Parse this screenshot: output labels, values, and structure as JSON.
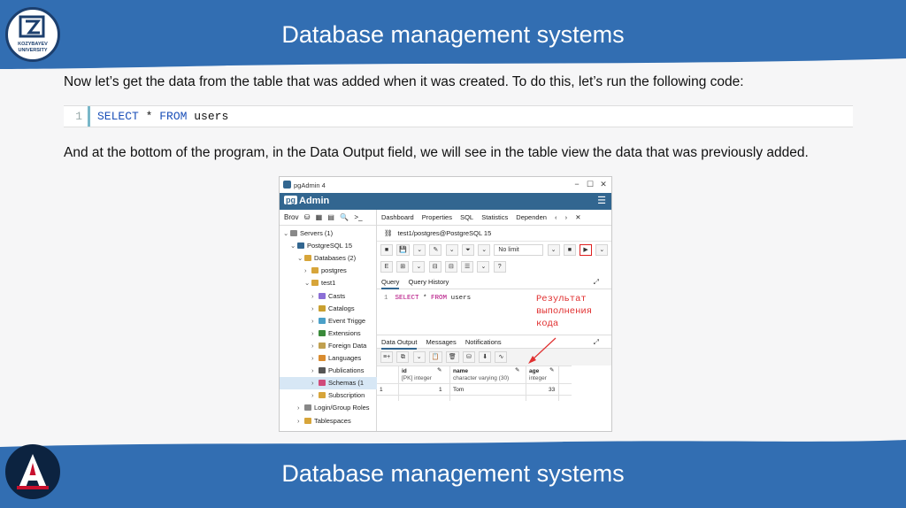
{
  "slide": {
    "title": "Database management systems",
    "footer_title": "Database management systems",
    "logo_text": "KOZYBAYEV UNIVERSITY",
    "para1": "Now let’s get the data from the table that was added when it was created. To do this, let’s run the following code:",
    "para2": "And at the bottom of the program, in the Data Output field, we will see in the table view the data that was previously added.",
    "code": {
      "line_number": "1",
      "kw1": "SELECT",
      "star": " * ",
      "kw2": "FROM",
      "rest": " users"
    }
  },
  "colors": {
    "band": "#326eb2",
    "band_dark": "#2a5f9a",
    "pgadmin": "#326690",
    "annotation": "#e03030"
  },
  "pgadmin": {
    "window_title": "pgAdmin 4",
    "brand_pg": "pg",
    "brand_admin": "Admin",
    "left_toolbar": [
      "Brov",
      "⛁",
      "▦",
      "▤",
      "🔍",
      ">_"
    ],
    "tree": [
      {
        "label": "Servers (1)",
        "chev": "⌄",
        "icon": "#888888"
      },
      {
        "label": "PostgreSQL 15",
        "chev": "⌄",
        "icon": "#326690"
      },
      {
        "label": "Databases (2)",
        "chev": "⌄",
        "icon": "#d7a53a"
      },
      {
        "label": "postgres",
        "chev": "›",
        "icon": "#d7a53a"
      },
      {
        "label": "test1",
        "chev": "⌄",
        "icon": "#d7a53a"
      },
      {
        "label": "Casts",
        "chev": "›",
        "icon": "#8b6fd6"
      },
      {
        "label": "Catalogs",
        "chev": "›",
        "icon": "#c9a030"
      },
      {
        "label": "Event Trigge",
        "chev": "›",
        "icon": "#4aa0c8"
      },
      {
        "label": "Extensions",
        "chev": "›",
        "icon": "#3a8a3a"
      },
      {
        "label": "Foreign Data",
        "chev": "›",
        "icon": "#c0a050"
      },
      {
        "label": "Languages",
        "chev": "›",
        "icon": "#d98c30"
      },
      {
        "label": "Publications",
        "chev": "›",
        "icon": "#555555"
      },
      {
        "label": "Schemas (1",
        "chev": "›",
        "icon": "#d04a7a"
      },
      {
        "label": "Subscription",
        "chev": "›",
        "icon": "#d7a53a"
      },
      {
        "label": "Login/Group Roles",
        "chev": "›",
        "icon": "#888888"
      },
      {
        "label": "Tablespaces",
        "chev": "›",
        "icon": "#d7a53a"
      }
    ],
    "tabs": [
      "Dashboard",
      "Properties",
      "SQL",
      "Statistics",
      "Dependen",
      "‹",
      "›",
      "✕"
    ],
    "connection": "test1/postgres@PostgreSQL 15",
    "toolbar1": [
      "■",
      "💾",
      "⌄",
      "✎",
      "⌄",
      "⏷",
      "⌄",
      "No limit",
      "⌄",
      "■",
      "▶",
      "⌄"
    ],
    "toolbar2": [
      "E",
      "⊞",
      "⌄",
      "⊟",
      "⊟",
      "☰",
      "⌄",
      "?"
    ],
    "query_tabs": [
      "Query",
      "Query History"
    ],
    "editor": {
      "line": "1",
      "kw1": "SELECT",
      "star": " * ",
      "kw2": "FROM",
      "rest": " users"
    },
    "annotation": [
      "Результат",
      "выполнения",
      "кода"
    ],
    "output_tabs": [
      "Data Output",
      "Messages",
      "Notifications"
    ],
    "output_toolbar": [
      "≡+",
      "⧉",
      "⌄",
      "📋",
      "🗑",
      "⛁",
      "⬇",
      "∿"
    ],
    "grid": {
      "columns": [
        {
          "name": "id",
          "type": "[PK] integer"
        },
        {
          "name": "name",
          "type": "character varying (30)"
        },
        {
          "name": "age",
          "type": "integer"
        }
      ],
      "rows": [
        {
          "row_num": "1",
          "id": "1",
          "name": "Tom",
          "age": "33"
        }
      ]
    }
  }
}
